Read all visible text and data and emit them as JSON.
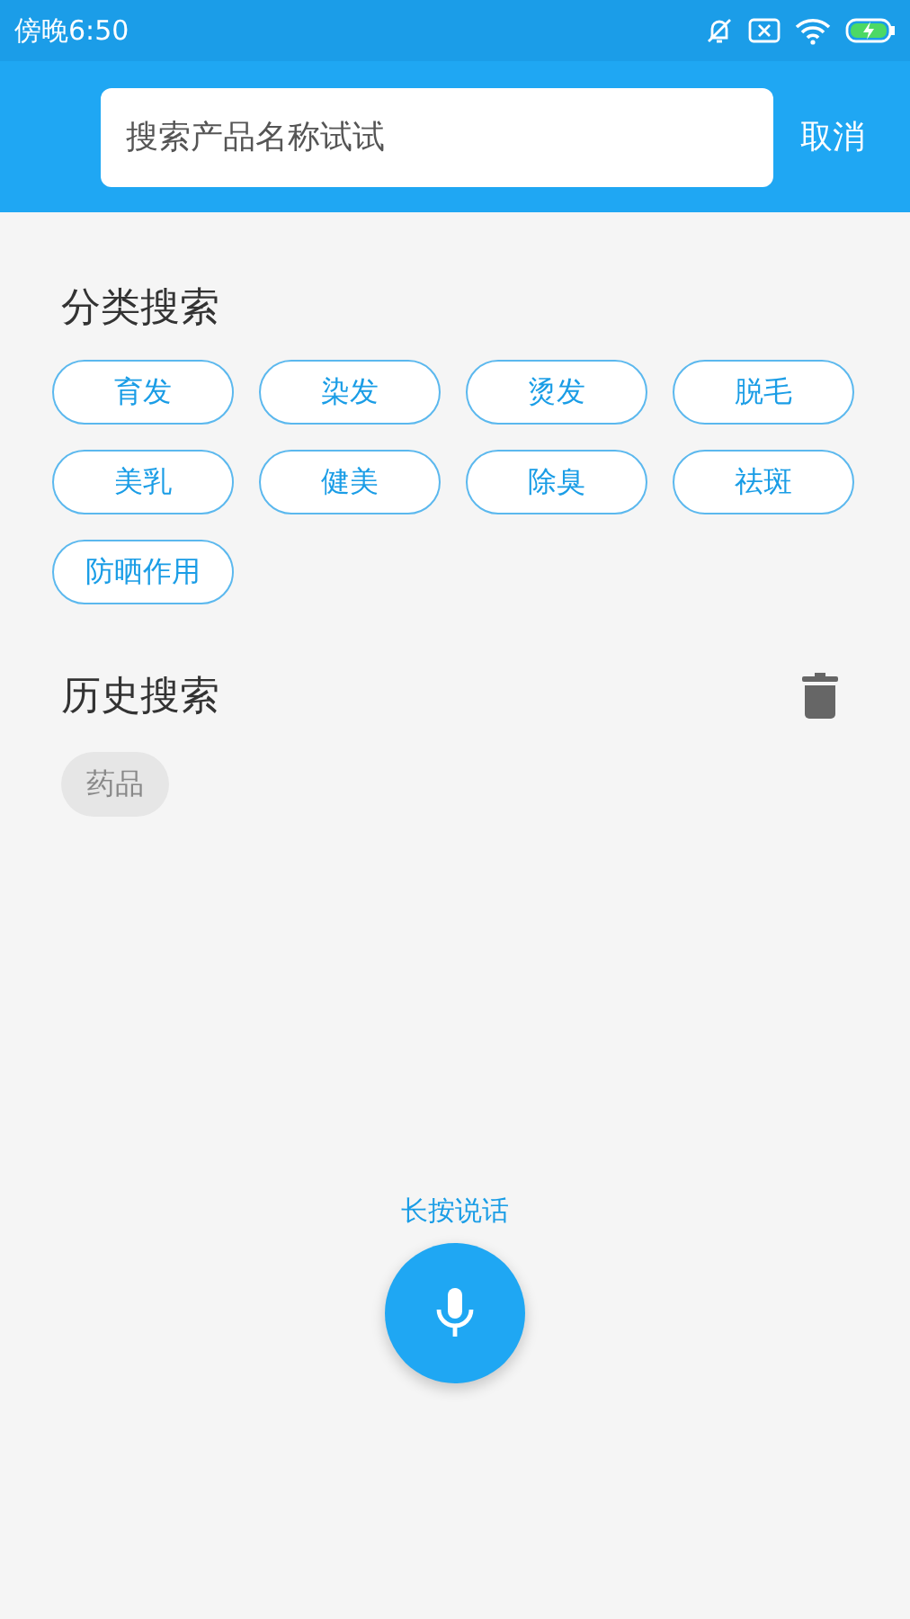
{
  "status_bar": {
    "time": "傍晚6:50"
  },
  "search": {
    "placeholder": "搜索产品名称试试",
    "cancel": "取消"
  },
  "categories": {
    "title": "分类搜索",
    "items": [
      "育发",
      "染发",
      "烫发",
      "脱毛",
      "美乳",
      "健美",
      "除臭",
      "祛斑",
      "防晒作用"
    ]
  },
  "history": {
    "title": "历史搜索",
    "items": [
      "药品"
    ]
  },
  "voice": {
    "label": "长按说话"
  }
}
